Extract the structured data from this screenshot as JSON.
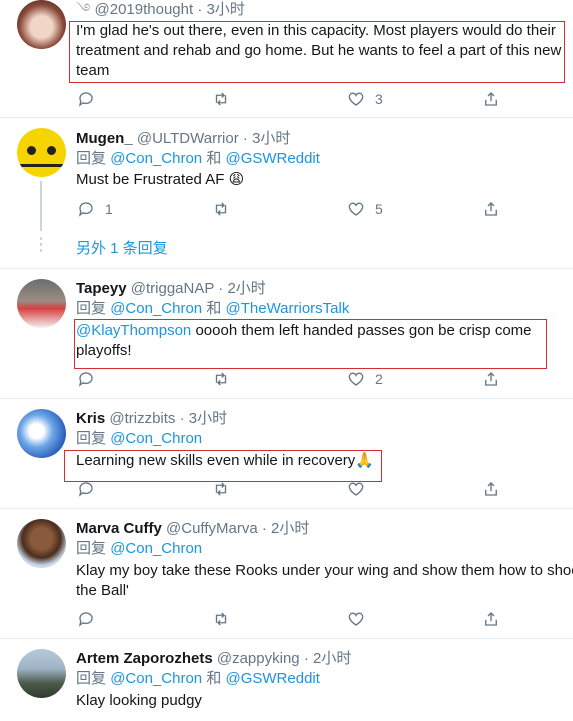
{
  "tweets": [
    {
      "handle": "@2019thought",
      "time": "3小时",
      "text": "I'm glad he's out there, even in this capacity. Most players would do their treatment and rehab and go home. But he wants to feel a part of this new team",
      "likes": "3"
    },
    {
      "name": "Mugen_",
      "handle": "@ULTDWarrior",
      "time": "3小时",
      "reply_prefix": "回复",
      "reply_to_1": "@Con_Chron",
      "reply_and": "和",
      "reply_to_2": "@GSWReddit",
      "text": "Must be Frustrated AF",
      "emoji": "😩",
      "replies": "1",
      "likes": "5",
      "more_replies": "另外 1 条回复"
    },
    {
      "name": "Tapeyy",
      "handle": "@triggaNAP",
      "time": "2小时",
      "reply_prefix": "回复",
      "reply_to_1": "@Con_Chron",
      "reply_and": "和",
      "reply_to_2": "@TheWarriorsTalk",
      "mention": "@KlayThompson",
      "text": " ooooh them left handed passes gon be crisp come playoffs!",
      "likes": "2"
    },
    {
      "name": "Kris",
      "handle": "@trizzbits",
      "time": "3小时",
      "reply_prefix": "回复",
      "reply_to_1": "@Con_Chron",
      "text": "Learning new skills even while in recovery",
      "emoji": "🙏"
    },
    {
      "name": "Marva Cuffy",
      "handle": "@CuffyMarva",
      "time": "2小时",
      "reply_prefix": "回复",
      "reply_to_1": "@Con_Chron",
      "text_line1": "Klay my boy take these Rooks under your wing and show them how to shoo",
      "text_line2": "the Ball'"
    },
    {
      "name": "Artem Zaporozhets",
      "handle": "@zappyking",
      "time": "2小时",
      "reply_prefix": "回复",
      "reply_to_1": "@Con_Chron",
      "reply_and": "和",
      "reply_to_2": "@GSWReddit",
      "text": "Klay looking pudgy"
    }
  ],
  "colors": {
    "link": "#1b95e0",
    "meta": "#657786",
    "highlight_box": "#d32f2f"
  }
}
